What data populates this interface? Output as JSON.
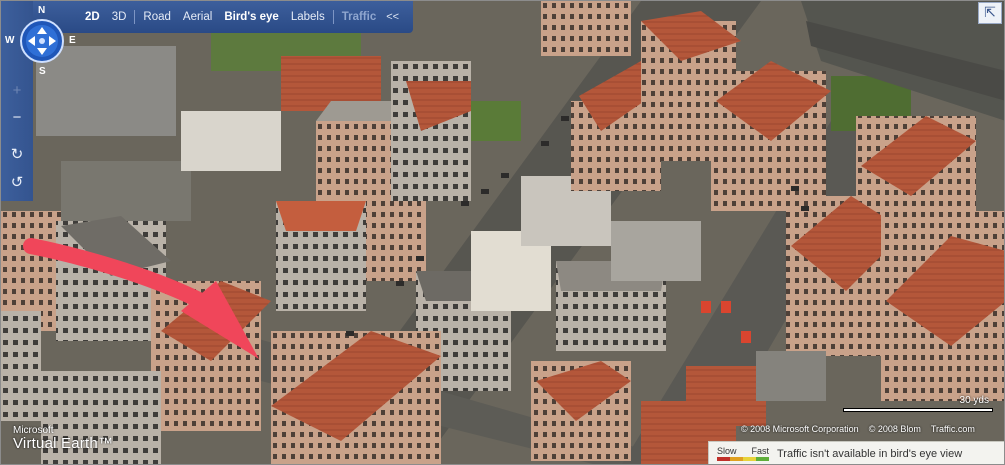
{
  "toolbar": {
    "items": [
      {
        "label": "2D",
        "state": "active"
      },
      {
        "label": "3D",
        "state": "normal"
      },
      {
        "label": "Road",
        "state": "normal"
      },
      {
        "label": "Aerial",
        "state": "normal"
      },
      {
        "label": "Bird's eye",
        "state": "active"
      },
      {
        "label": "Labels",
        "state": "normal"
      },
      {
        "label": "Traffic",
        "state": "disabled"
      }
    ],
    "collapse_label": "<<"
  },
  "compass": {
    "n": "N",
    "s": "S",
    "w": "W",
    "e": "E"
  },
  "controls": {
    "zoom_in": "+",
    "zoom_out": "−",
    "rotate_cw": "↻",
    "rotate_ccw": "↺"
  },
  "expand_label": "⇱",
  "branding": {
    "line1": "Microsoft",
    "line2": "Virtual Earth™"
  },
  "scale": {
    "label": "30 yds"
  },
  "copyright": {
    "microsoft": "© 2008 Microsoft Corporation",
    "blom": "© 2008 Blom",
    "traffic": "Traffic.com"
  },
  "traffic": {
    "legend_slow": "Slow",
    "legend_fast": "Fast",
    "legend_colors": [
      "#c0302a",
      "#e0a020",
      "#e7d33a",
      "#5fae3a"
    ],
    "message": "Traffic isn't available in bird's eye view"
  },
  "colors": {
    "toolbar_bg": "#2f4f8c",
    "roof_terracotta": "#b4573a",
    "arrow": "#f0465a"
  }
}
